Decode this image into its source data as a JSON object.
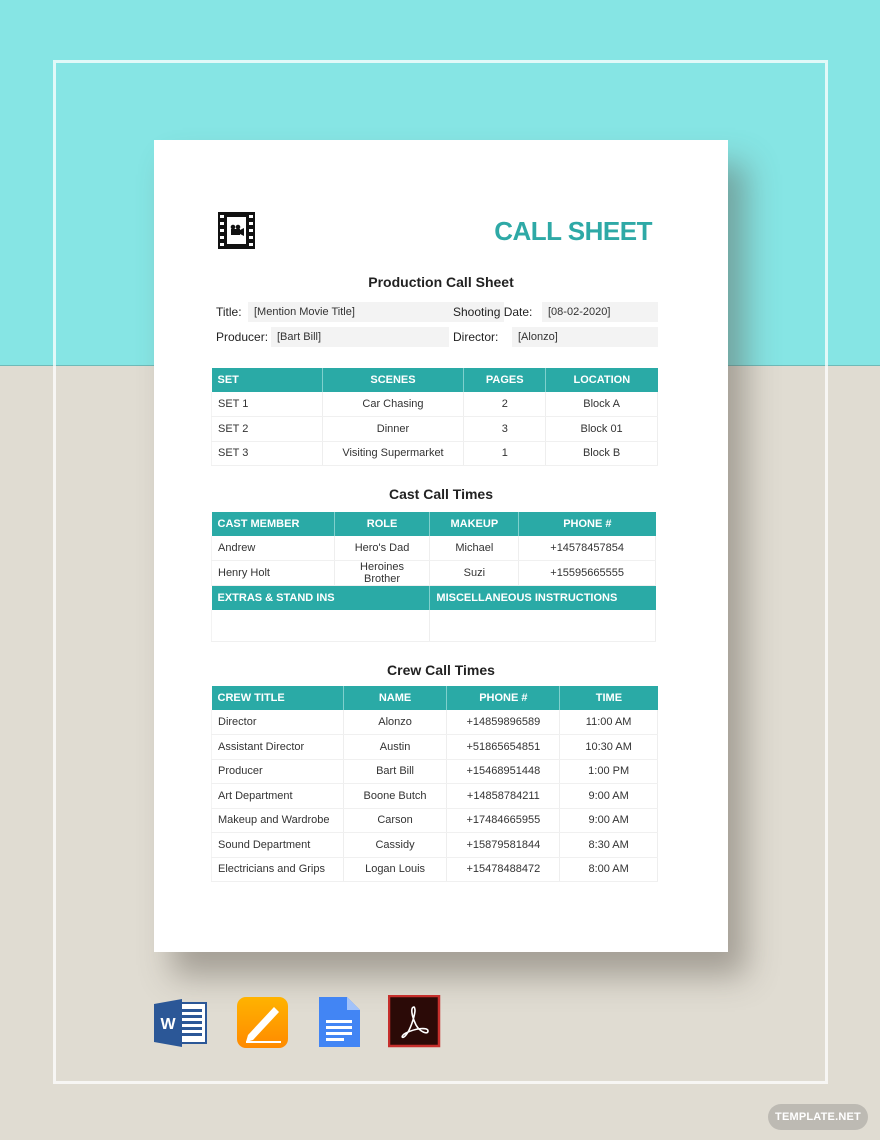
{
  "header": {
    "logo_icon": "film-camera-icon",
    "doc_title": "CALL SHEET",
    "section_title": "Production Call Sheet"
  },
  "info": {
    "title_label": "Title:",
    "title_value": "[Mention Movie Title]",
    "shooting_date_label": "Shooting Date:",
    "shooting_date_value": "[08-02-2020]",
    "producer_label": "Producer:",
    "producer_value": "[Bart Bill]",
    "director_label": "Director:",
    "director_value": "[Alonzo]"
  },
  "sets_table": {
    "headers": [
      "SET",
      "SCENES",
      "PAGES",
      "LOCATION"
    ],
    "rows": [
      [
        "SET 1",
        "Car Chasing",
        "2",
        "Block A"
      ],
      [
        "SET 2",
        "Dinner",
        "3",
        "Block 01"
      ],
      [
        "SET 3",
        "Visiting Supermarket",
        "1",
        "Block B"
      ]
    ]
  },
  "cast": {
    "title": "Cast Call Times",
    "headers": [
      "CAST MEMBER",
      "ROLE",
      "MAKEUP",
      "PHONE #"
    ],
    "rows": [
      [
        "Andrew",
        "Hero's Dad",
        "Michael",
        "+14578457854"
      ],
      [
        "Henry Holt",
        "Heroines Brother",
        "Suzi",
        "+15595665555"
      ]
    ],
    "extras_header": "EXTRAS & STAND INS",
    "misc_header": "MISCELLANEOUS INSTRUCTIONS",
    "extras_value": "",
    "misc_value": ""
  },
  "crew": {
    "title": "Crew Call Times",
    "headers": [
      "CREW TITLE",
      "NAME",
      "PHONE #",
      "TIME"
    ],
    "rows": [
      [
        "Director",
        "Alonzo",
        "+14859896589",
        "11:00 AM"
      ],
      [
        "Assistant Director",
        "Austin",
        "+51865654851",
        "10:30 AM"
      ],
      [
        "Producer",
        "Bart Bill",
        "+15468951448",
        "1:00 PM"
      ],
      [
        "Art Department",
        "Boone Butch",
        "+14858784211",
        "9:00 AM"
      ],
      [
        "Makeup and Wardrobe",
        "Carson",
        "+17484665955",
        "9:00 AM"
      ],
      [
        "Sound Department",
        "Cassidy",
        "+15879581844",
        "8:30 AM"
      ],
      [
        "Electricians and Grips",
        "Logan Louis",
        "+15478488472",
        "8:00 AM"
      ]
    ]
  },
  "formats": [
    {
      "name": "Microsoft Word",
      "icon": "word-icon",
      "letter": "W"
    },
    {
      "name": "Apple Pages",
      "icon": "pages-icon"
    },
    {
      "name": "Google Docs",
      "icon": "google-docs-icon"
    },
    {
      "name": "Adobe PDF",
      "icon": "pdf-icon"
    }
  ],
  "watermark": "TEMPLATE.NET",
  "colors": {
    "accent": "#2aaaa6",
    "bg_top": "#86e5e4",
    "bg_bottom": "#e0dcd2"
  }
}
